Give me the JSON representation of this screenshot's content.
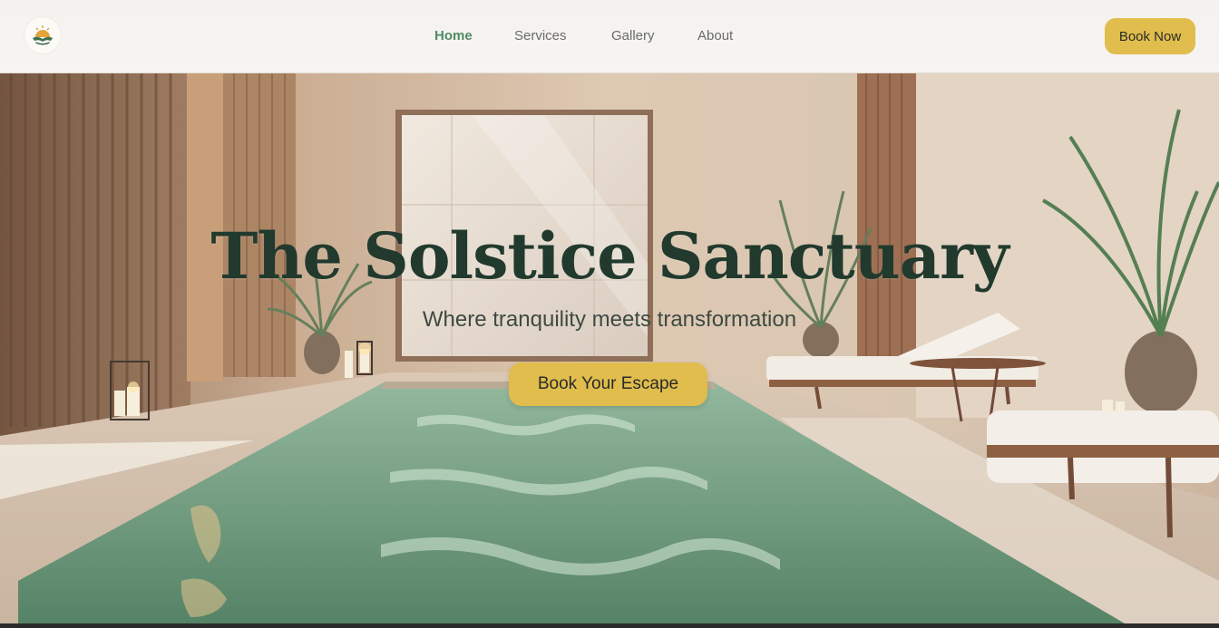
{
  "brand": {
    "logo_icon": "sunrise-hands-logo-icon"
  },
  "nav": {
    "items": [
      {
        "label": "Home",
        "active": true
      },
      {
        "label": "Services",
        "active": false
      },
      {
        "label": "Gallery",
        "active": false
      },
      {
        "label": "About",
        "active": false
      }
    ],
    "cta_label": "Book Now"
  },
  "hero": {
    "title": "The Solstice Sanctuary",
    "subtitle": "Where tranquility meets transformation",
    "cta_label": "Book Your Escape"
  },
  "colors": {
    "accent": "#e0bd4c",
    "nav_active": "#4f8a64",
    "title": "#223a2e",
    "pool_water": "#6f9a7c"
  }
}
